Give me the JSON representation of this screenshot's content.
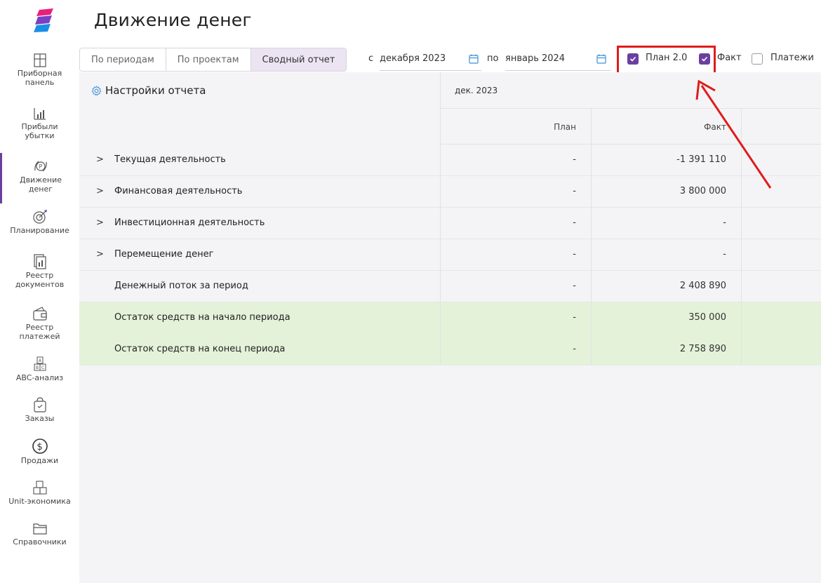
{
  "page_title": "Движение денег",
  "sidebar": {
    "items": [
      {
        "label": "Приборная\nпанель",
        "icon": "dashboard-icon"
      },
      {
        "label": "Прибыли\nубытки",
        "icon": "bar-chart-icon"
      },
      {
        "label": "Движение\nденег",
        "icon": "money-flow-icon",
        "active": true
      },
      {
        "label": "Планирование",
        "icon": "target-icon"
      },
      {
        "label": "Реестр\nдокументов",
        "icon": "documents-icon"
      },
      {
        "label": "Реестр\nплатежей",
        "icon": "wallet-icon"
      },
      {
        "label": "ABC-анализ",
        "icon": "abc-icon"
      },
      {
        "label": "Заказы",
        "icon": "bag-icon"
      },
      {
        "label": "Продажи",
        "icon": "dollar-icon"
      },
      {
        "label": "Unit-экономика",
        "icon": "boxes-icon"
      },
      {
        "label": "Справочники",
        "icon": "folder-icon"
      }
    ]
  },
  "tabs": [
    {
      "label": "По периодам",
      "active": false
    },
    {
      "label": "По проектам",
      "active": false
    },
    {
      "label": "Сводный отчет",
      "active": true
    }
  ],
  "date_range": {
    "from_label": "с",
    "from_value": "декабря 2023",
    "to_label": "по",
    "to_value": "январь 2024"
  },
  "checkboxes": [
    {
      "label": "План 2.0",
      "checked": true
    },
    {
      "label": "Факт",
      "checked": true
    },
    {
      "label": "Платежи",
      "checked": false
    }
  ],
  "report": {
    "settings_label": "Настройки отчета",
    "month": "дек. 2023",
    "columns": [
      "План",
      "Факт"
    ],
    "rows": [
      {
        "label": "Текущая деятельность",
        "expandable": true,
        "plan": "-",
        "fact": "-1 391 110",
        "highlight": false
      },
      {
        "label": "Финансовая деятельность",
        "expandable": true,
        "plan": "-",
        "fact": "3 800 000",
        "highlight": false
      },
      {
        "label": "Инвестиционная деятельность",
        "expandable": true,
        "plan": "-",
        "fact": "-",
        "highlight": false
      },
      {
        "label": "Перемещение денег",
        "expandable": true,
        "plan": "-",
        "fact": "-",
        "highlight": false
      },
      {
        "label": "Денежный поток за период",
        "expandable": false,
        "plan": "-",
        "fact": "2 408 890",
        "highlight": false
      },
      {
        "label": "Остаток средств на начало периода",
        "expandable": false,
        "plan": "-",
        "fact": "350 000",
        "highlight": true
      },
      {
        "label": "Остаток средств на конец периода",
        "expandable": false,
        "plan": "-",
        "fact": "2 758 890",
        "highlight": true
      }
    ]
  },
  "colors": {
    "accent": "#6b3fa0",
    "active_tab_bg": "#ece4f3",
    "highlight_row_bg": "#e3f2d9",
    "annotation_red": "#e01b1b"
  }
}
